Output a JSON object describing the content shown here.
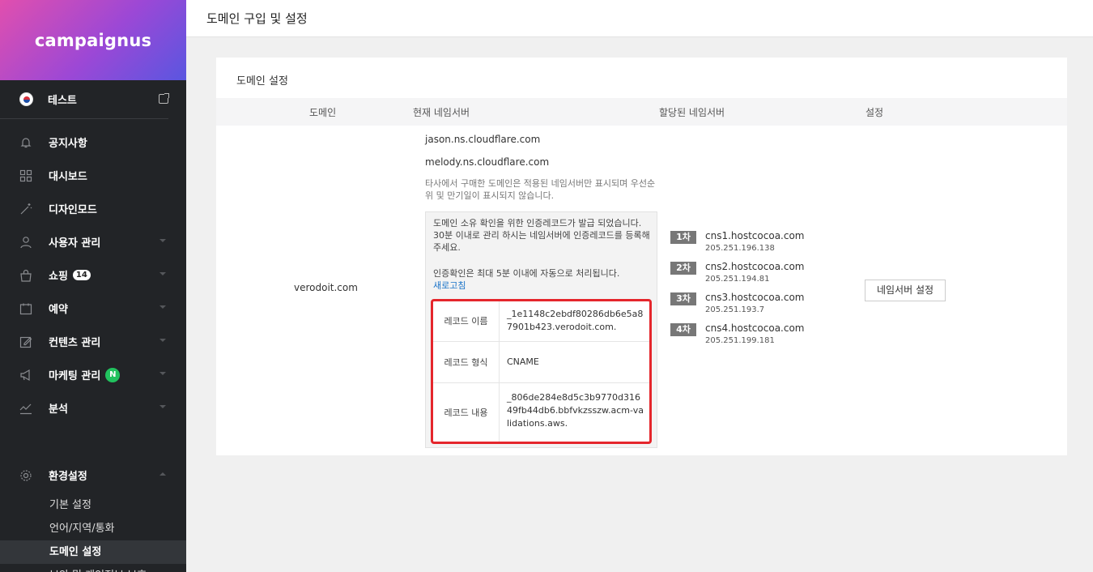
{
  "brand": {
    "name": "campaignus"
  },
  "site": {
    "name": "테스트"
  },
  "sidebar": {
    "items": [
      {
        "label": "공지사항",
        "icon": "bell-icon"
      },
      {
        "label": "대시보드",
        "icon": "grid-icon"
      },
      {
        "label": "디자인모드",
        "icon": "magic-wand-icon"
      },
      {
        "label": "사용자 관리",
        "icon": "user-icon"
      },
      {
        "label": "쇼핑",
        "icon": "shopping-bag-icon",
        "badge": "14"
      },
      {
        "label": "예약",
        "icon": "calendar-icon"
      },
      {
        "label": "컨텐츠 관리",
        "icon": "edit-icon"
      },
      {
        "label": "마케팅 관리",
        "icon": "megaphone-icon",
        "badge": "N"
      },
      {
        "label": "분석",
        "icon": "chart-icon"
      }
    ],
    "settings": {
      "label": "환경설정",
      "icon": "gear-icon"
    },
    "subitems": [
      {
        "label": "기본 설정"
      },
      {
        "label": "언어/지역/통화"
      },
      {
        "label": "도메인 설정",
        "active": true
      },
      {
        "label": "보안 및 개인정보 보호"
      }
    ]
  },
  "header": {
    "title": "도메인 구입 및 설정"
  },
  "panel": {
    "title": "도메인 설정",
    "columns": {
      "domain": "도메인",
      "current_ns": "현재 네임서버",
      "assigned_ns": "할당된 네임서버",
      "settings": "설정"
    },
    "domain": "verodoit.com",
    "current_ns": [
      "jason.ns.cloudflare.com",
      "melody.ns.cloudflare.com"
    ],
    "note": "타사에서 구매한 도메인은 적용된 네임서버만 표시되며 우선순위 및 만기일이 표시되지 않습니다.",
    "verify_text": "도메인 소유 확인을 위한 인증레코드가 발급 되었습니다. 30분 이내로 관리 하시는 네임서버에 인증레코드를 등록해 주세요.",
    "verify_text2": "인증확인은 최대 5분 이내에 자동으로 처리됩니다.",
    "refresh_label": "새로고침",
    "records": [
      {
        "key": "레코드 이름",
        "value": "_1e1148c2ebdf80286db6e5a87901b423.verodoit.com."
      },
      {
        "key": "레코드 형식",
        "value": "CNAME"
      },
      {
        "key": "레코드 내용",
        "value": "_806de284e8d5c3b9770d31649fb44db6.bbfvkzsszw.acm-validations.aws."
      }
    ],
    "assigned": [
      {
        "rank": "1차",
        "host": "cns1.hostcocoa.com",
        "ip": "205.251.196.138"
      },
      {
        "rank": "2차",
        "host": "cns2.hostcocoa.com",
        "ip": "205.251.194.81"
      },
      {
        "rank": "3차",
        "host": "cns3.hostcocoa.com",
        "ip": "205.251.193.7"
      },
      {
        "rank": "4차",
        "host": "cns4.hostcocoa.com",
        "ip": "205.251.199.181"
      }
    ],
    "ns_button": "네임서버 설정"
  },
  "colors": {
    "brand_gradient_start": "#e14fae",
    "brand_gradient_end": "#5a56e0",
    "sidebar_bg": "#222427",
    "highlight_border": "#e5262c",
    "link": "#1a73c8",
    "badge_green": "#21c25e"
  }
}
